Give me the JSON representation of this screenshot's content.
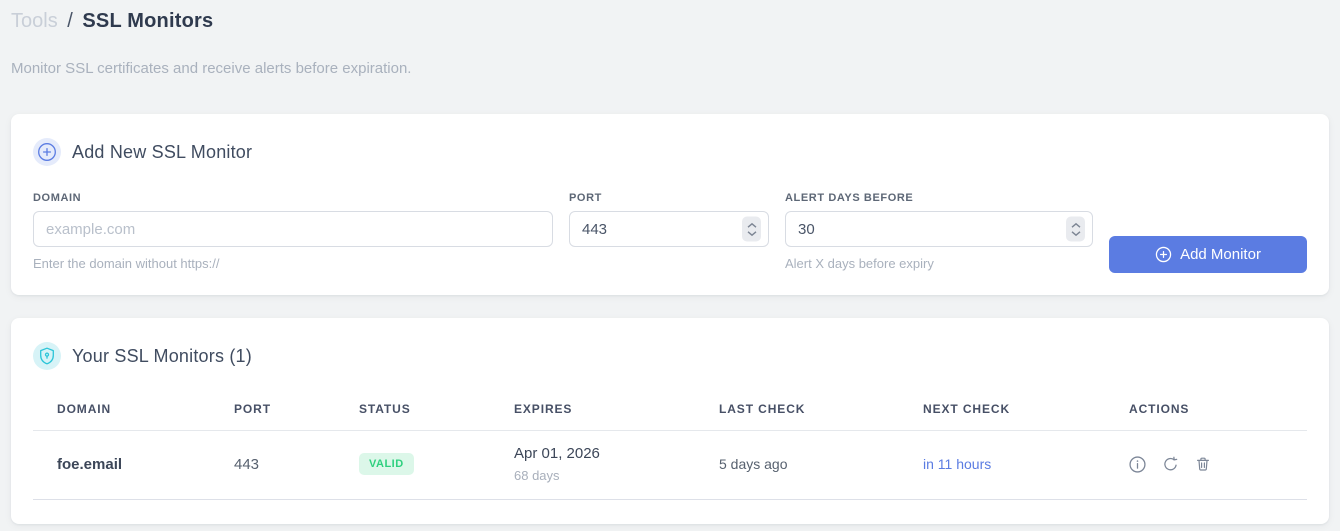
{
  "breadcrumb": {
    "section": "Tools",
    "separator": "/",
    "page": "SSL Monitors"
  },
  "subtitle": "Monitor SSL certificates and receive alerts before expiration.",
  "colors": {
    "accent_blue": "#5b7ce2",
    "badge_blue_bg": "#e5ebfb",
    "teal": "#2bc5d8",
    "badge_teal_bg": "#d7f3f7",
    "valid_green": "#2fd07f",
    "valid_green_bg": "#dcf7e9",
    "page_bg": "#f1f3f4"
  },
  "add_card": {
    "title": "Add New SSL Monitor",
    "fields": {
      "domain": {
        "label": "DOMAIN",
        "placeholder": "example.com",
        "helper": "Enter the domain without https://"
      },
      "port": {
        "label": "PORT",
        "value": "443"
      },
      "alert_days": {
        "label": "ALERT DAYS BEFORE",
        "value": "30",
        "helper": "Alert X days before expiry"
      }
    },
    "submit_label": "Add Monitor",
    "icons": [
      "plus-circle-icon"
    ]
  },
  "monitors_card": {
    "title": "Your SSL Monitors (1)",
    "icon": "shield-lock-icon",
    "table": {
      "headers": [
        "DOMAIN",
        "PORT",
        "STATUS",
        "EXPIRES",
        "LAST CHECK",
        "NEXT CHECK",
        "ACTIONS"
      ],
      "rows": [
        {
          "domain": "foe.email",
          "port": "443",
          "status": "VALID",
          "expires_date": "Apr 01, 2026",
          "expires_days": "68 days",
          "last_check": "5 days ago",
          "next_check": "in 11 hours",
          "actions": [
            "info-icon",
            "refresh-icon",
            "trash-icon"
          ]
        }
      ]
    }
  }
}
